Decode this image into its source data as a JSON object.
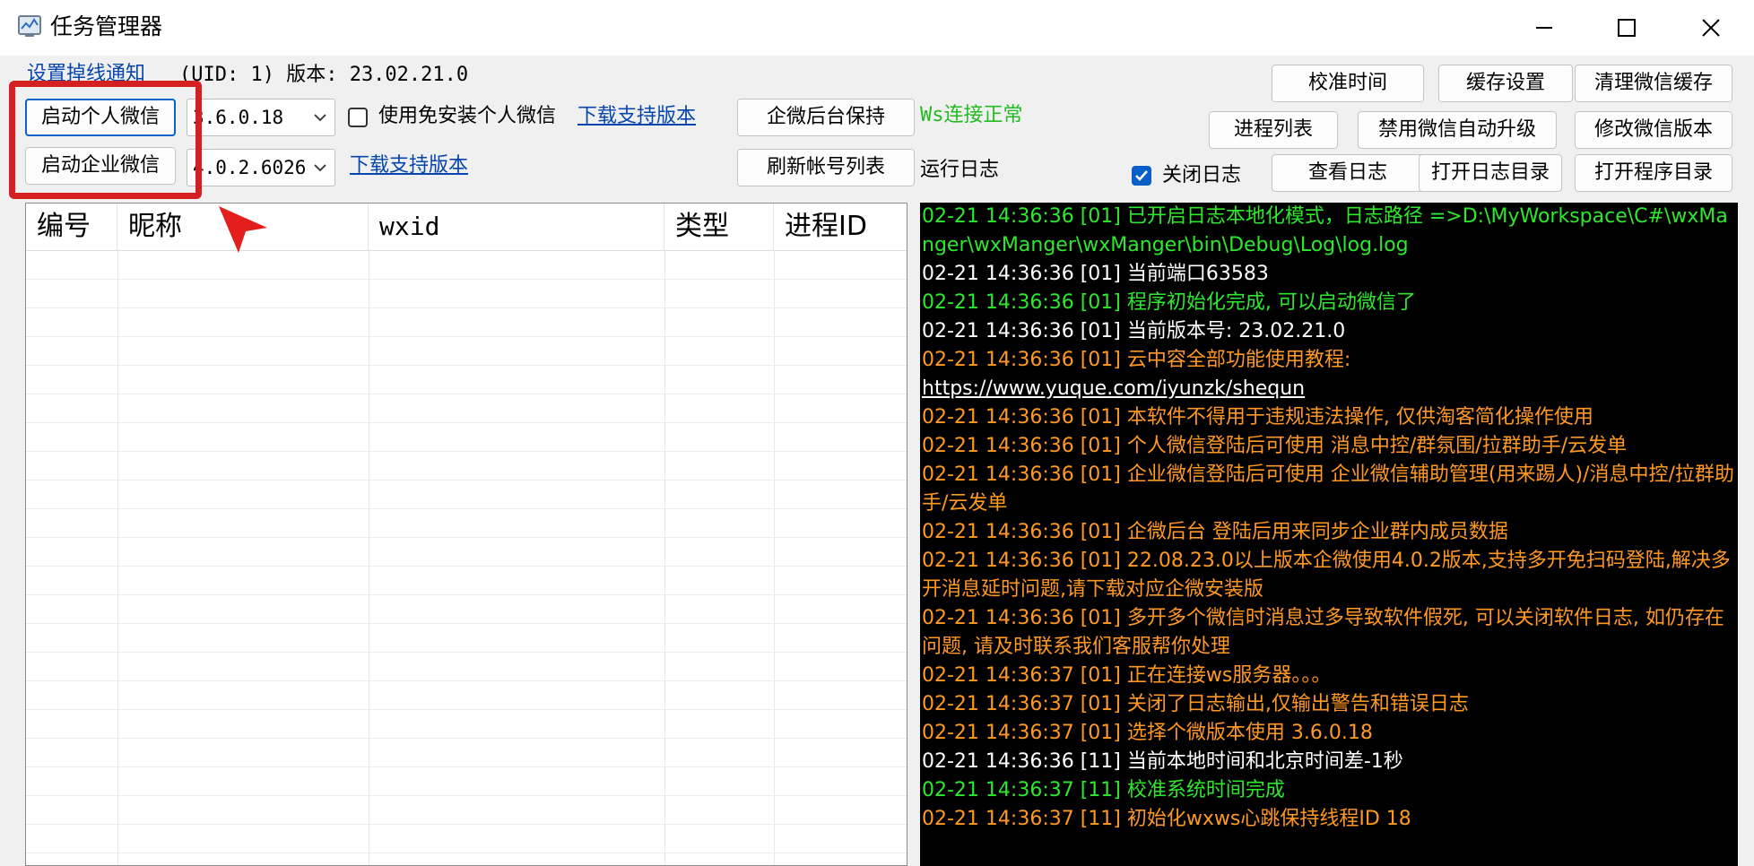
{
  "window": {
    "title": "任务管理器",
    "controls": [
      "minimize",
      "maximize",
      "close"
    ]
  },
  "top": {
    "notify_link": "设置掉线通知",
    "uid_version": "(UID: 1) 版本: 23.02.21.0",
    "ws_status": "Ws连接正常",
    "ws_status_color": "#22bb22",
    "run_log_label": "运行日志"
  },
  "personal": {
    "start_button": "启动个人微信",
    "version_value": "3.6.0.18",
    "portable_checkbox_label": "使用免安装个人微信",
    "portable_checked": false,
    "download_link": "下载支持版本"
  },
  "enterprise": {
    "start_button": "启动企业微信",
    "version_value": "4.0.2.6026",
    "download_link": "下载支持版本"
  },
  "middle_buttons": {
    "wecom_keepalive": "企微后台保持",
    "refresh_accounts": "刷新帐号列表"
  },
  "right_buttons": {
    "calibrate_time": "校准时间",
    "cache_settings": "缓存设置",
    "clear_wechat_cache": "清理微信缓存",
    "process_list": "进程列表",
    "disable_auto_upgrade": "禁用微信自动升级",
    "modify_version": "修改微信版本",
    "view_log": "查看日志",
    "open_log_dir": "打开日志目录",
    "open_program_dir": "打开程序目录"
  },
  "close_log": {
    "label": "关闭日志",
    "checked": true
  },
  "accounts_table": {
    "columns": [
      "编号",
      "昵称",
      "wxid",
      "类型",
      "进程ID"
    ],
    "rows": []
  },
  "log": {
    "colors": {
      "green": "#2ee82e",
      "white": "#ffffff",
      "orange": "#ff9922"
    },
    "lines": [
      {
        "text": "02-21 14:36:36 [01] 已开启日志本地化模式，日志路径 =>D:\\MyWorkspace\\C#\\wxManger\\wxManger\\wxManger\\bin\\Debug\\Log\\log.log",
        "color": "green"
      },
      {
        "text": "02-21 14:36:36 [01] 当前端口63583",
        "color": "white"
      },
      {
        "text": "02-21 14:36:36 [01] 程序初始化完成, 可以启动微信了",
        "color": "green"
      },
      {
        "text": "02-21 14:36:36 [01] 当前版本号: 23.02.21.0",
        "color": "white"
      },
      {
        "text": "02-21 14:36:36 [01] 云中容全部功能使用教程:",
        "color": "orange"
      },
      {
        "text": "https://www.yuque.com/iyunzk/shequn",
        "color": "white",
        "underline": true
      },
      {
        "text": "02-21 14:36:36 [01] 本软件不得用于违规违法操作, 仅供淘客简化操作使用",
        "color": "orange"
      },
      {
        "text": "02-21 14:36:36 [01] 个人微信登陆后可使用 消息中控/群氛围/拉群助手/云发单",
        "color": "orange"
      },
      {
        "text": "02-21 14:36:36 [01] 企业微信登陆后可使用 企业微信辅助管理(用来踢人)/消息中控/拉群助手/云发单",
        "color": "orange"
      },
      {
        "text": "02-21 14:36:36 [01] 企微后台 登陆后用来同步企业群内成员数据",
        "color": "orange"
      },
      {
        "text": "02-21 14:36:36 [01] 22.08.23.0以上版本企微使用4.0.2版本,支持多开免扫码登陆,解决多开消息延时问题,请下载对应企微安装版",
        "color": "orange"
      },
      {
        "text": "02-21 14:36:36 [01] 多开多个微信时消息过多导致软件假死, 可以关闭软件日志, 如仍存在问题, 请及时联系我们客服帮你处理",
        "color": "orange"
      },
      {
        "text": "02-21 14:36:37 [01] 正在连接ws服务器。。。",
        "color": "orange"
      },
      {
        "text": "02-21 14:36:37 [01] 关闭了日志输出,仅输出警告和错误日志",
        "color": "orange"
      },
      {
        "text": "02-21 14:36:37 [01] 选择个微版本使用 3.6.0.18",
        "color": "orange"
      },
      {
        "text": "02-21 14:36:36 [11] 当前本地时间和北京时间差-1秒",
        "color": "white"
      },
      {
        "text": "02-21 14:36:37 [11] 校准系统时间完成",
        "color": "green"
      },
      {
        "text": "02-21 14:36:37 [11] 初始化wxws心跳保持线程ID 18",
        "color": "orange"
      }
    ]
  }
}
